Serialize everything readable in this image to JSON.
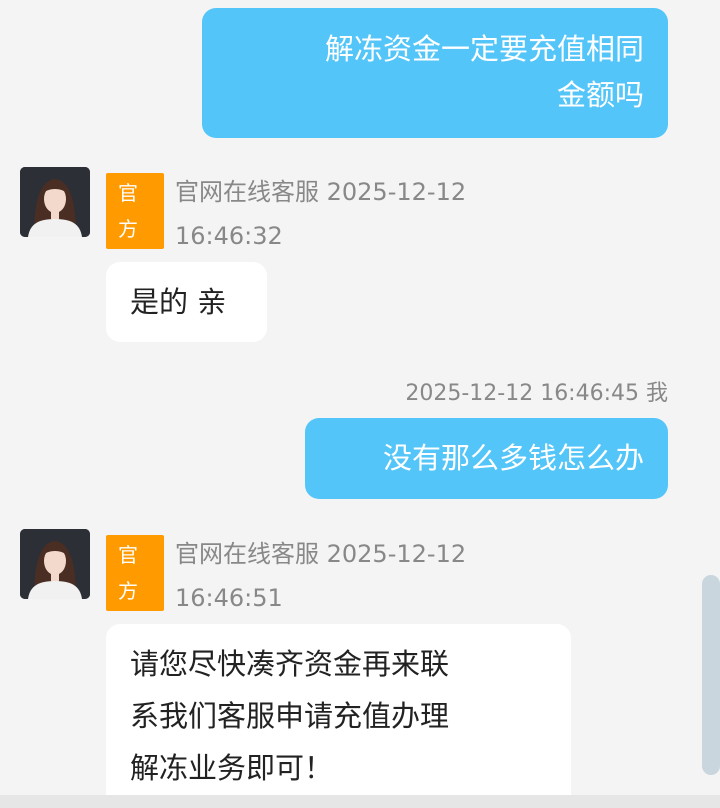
{
  "messages": {
    "m1": {
      "direction": "outgoing",
      "lines": [
        "解冻资金一定要充值相同",
        "金额吗"
      ]
    },
    "m2": {
      "direction": "incoming",
      "badge": [
        "官",
        "方"
      ],
      "sender_line1": "官网在线客服 2025-12-12",
      "sender_line2": "16:46:32",
      "text": "是的 亲"
    },
    "m3": {
      "direction": "outgoing",
      "time": "2025-12-12 16:46:45 我",
      "text": "没有那么多钱怎么办"
    },
    "m4": {
      "direction": "incoming",
      "badge": [
        "官",
        "方"
      ],
      "sender_line1": "官网在线客服 2025-12-12",
      "sender_line2": "16:46:51",
      "lines": [
        "请您尽快凑齐资金再来联",
        "系我们客服申请充值办理",
        "解冻业务即可！"
      ]
    }
  },
  "colors": {
    "outgoing_bubble": "#54c5f8",
    "incoming_bubble": "#ffffff",
    "badge": "#ff9a00",
    "background": "#f4f4f4"
  },
  "icons": {
    "avatar": "agent-avatar-photo"
  }
}
